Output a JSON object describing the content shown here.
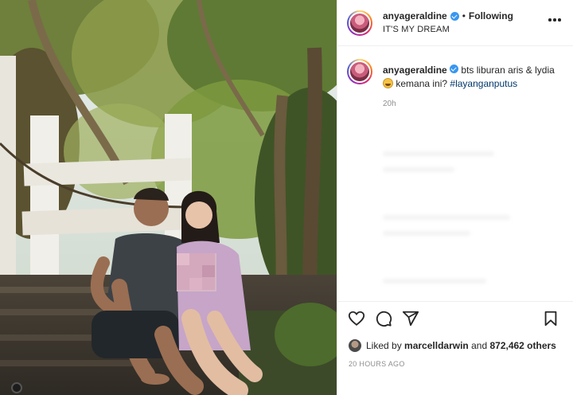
{
  "post": {
    "username": "anyageraldine",
    "separator": "•",
    "follow_state": "Following",
    "subtitle": "IT'S MY DREAM"
  },
  "caption": {
    "username": "anyageraldine",
    "text_line1": "bts liburan aris & lydia",
    "text_line2": "kemana ini?",
    "hashtag": "#layanganputus",
    "time_ago": "20h"
  },
  "likes": {
    "prefix": "Liked by",
    "liked_user": "marcelldarwin",
    "joiner": "and",
    "count_text": "872,462 others"
  },
  "post_date": "20 HOURS AGO",
  "icons": {
    "like": "heart-icon",
    "comment": "comment-icon",
    "share": "send-icon",
    "save": "bookmark-icon",
    "more": "more-options-icon",
    "verified": "verified-badge-icon"
  },
  "colors": {
    "verified_blue": "#3897f0",
    "hashtag": "#00376b",
    "muted_text": "#8e8e8e"
  }
}
